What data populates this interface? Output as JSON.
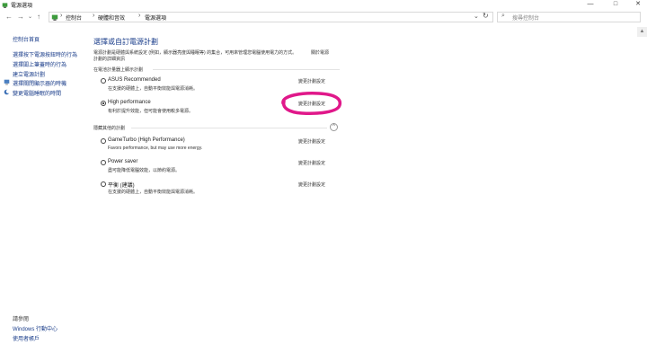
{
  "window": {
    "title": "電源選項",
    "minimize": "—",
    "maximize": "□",
    "close": "✕"
  },
  "nav": {
    "back": "←",
    "forward": "→",
    "recent": "⌄",
    "up": "↑"
  },
  "address": {
    "separator": "›",
    "breadcrumbs": [
      "控制台",
      "硬體和音效",
      "電源選項"
    ],
    "dropdown": "⌄",
    "refresh": "↻"
  },
  "search": {
    "placeholder": "搜尋控制台"
  },
  "sidebar": {
    "home": "控制台首頁",
    "items": [
      "選擇按下電源按鈕時的行為",
      "選擇闔上筆蓋時的行為",
      "建立電源計劃",
      "選擇關閉顯示器的時機",
      "變更電腦睡眠的時間"
    ],
    "see_also_title": "請參閱",
    "see_also": [
      "Windows 行動中心",
      "使用者帳戶"
    ]
  },
  "main": {
    "title": "選擇或自訂電源計劃",
    "desc_line1": "電源計劃是硬體與系統設定 (例如，顯示器亮度與睡眠等) 的集合，可用來管理您電腦使用電力的方式。",
    "desc_link1": "關於電源",
    "desc_link2": "計劃的詳細資訊",
    "shown_title": "在電池計量器上顯示計劃",
    "hidden_title": "隱藏其他的計劃",
    "change_label": "變更計劃設定",
    "plans": [
      {
        "name": "ASUS Recommended",
        "desc": "在支援的硬體上，自動平衡效能與電源消耗。",
        "selected": false
      },
      {
        "name": "High performance",
        "desc": "有利於提升效能，但可能會使用較多電源。",
        "selected": true
      },
      {
        "name": "GameTurbo (High Performance)",
        "desc": "Favors performance, but may use more energy.",
        "selected": false
      },
      {
        "name": "Power saver",
        "desc": "盡可能降低電腦效能，以節約電源。",
        "selected": false
      },
      {
        "name": "平衡 (建議)",
        "desc": "在支援的硬體上，自動平衡效能與電源消耗。",
        "selected": false
      }
    ]
  },
  "colors": {
    "link": "#1a3d8a",
    "highlight": "#e0188a"
  }
}
